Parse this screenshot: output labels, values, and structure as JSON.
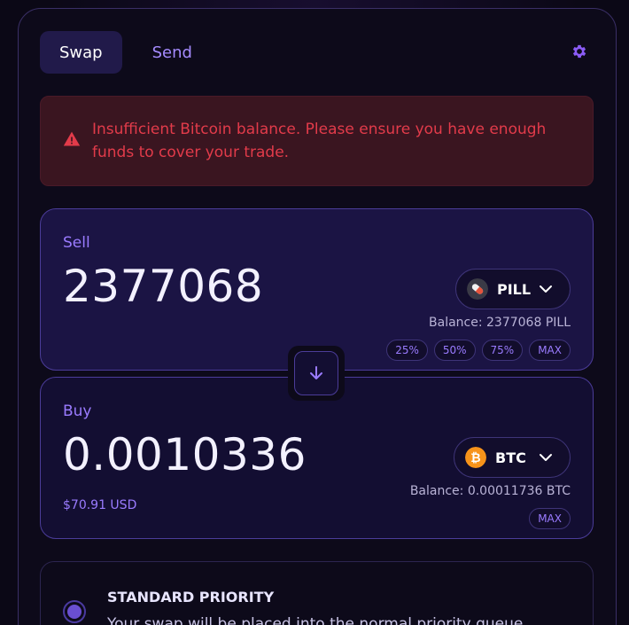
{
  "tabs": [
    {
      "label": "Swap",
      "active": true
    },
    {
      "label": "Send",
      "active": false
    }
  ],
  "alert": {
    "icon": "warning-triangle-icon",
    "message": "Insufficient Bitcoin balance. Please ensure you have enough funds to cover your trade."
  },
  "sell": {
    "label": "Sell",
    "amount": "2377068",
    "token": "PILL",
    "balance": "Balance: 2377068 PILL",
    "quick_amounts": [
      "25%",
      "50%",
      "75%",
      "MAX"
    ]
  },
  "buy": {
    "label": "Buy",
    "amount": "0.0010336",
    "usd_value": "$70.91 USD",
    "token": "BTC",
    "balance": "Balance: 0.00011736 BTC",
    "quick_amounts": [
      "MAX"
    ]
  },
  "priority": {
    "title": "STANDARD PRIORITY",
    "description": "Your swap will be placed into the normal priority queue"
  },
  "colors": {
    "accent": "#9a7bff",
    "error": "#e23b4a",
    "btc": "#f7931a"
  }
}
